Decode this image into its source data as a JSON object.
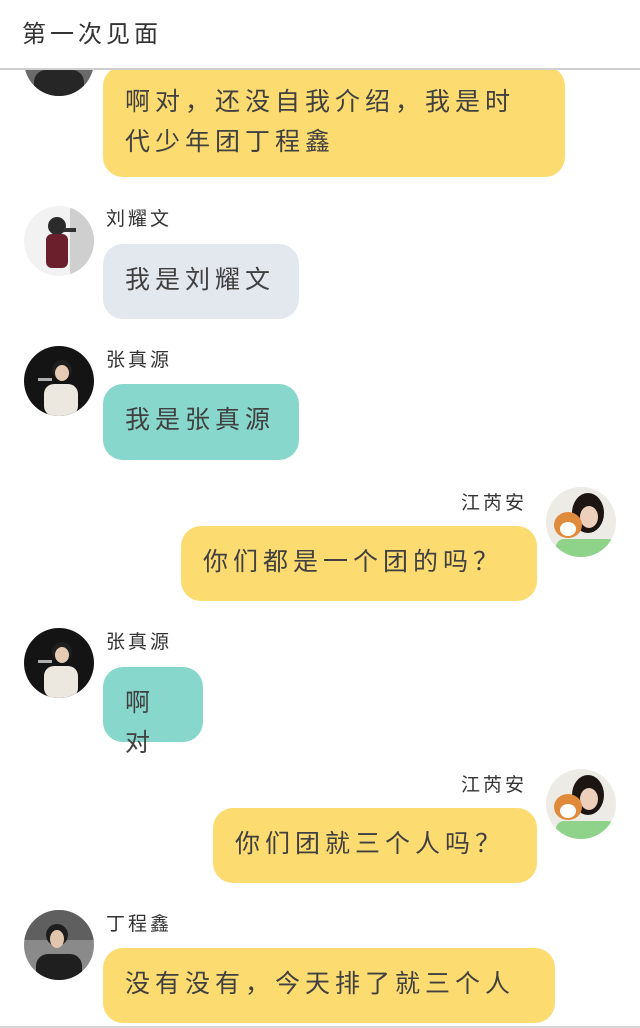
{
  "header": {
    "title": "第一次见面"
  },
  "messages": [
    {
      "sender": "",
      "text": "啊对，还没自我介绍，我是时代少年团丁程鑫",
      "color": "#fcdb71"
    },
    {
      "sender": "刘耀文",
      "text": "我是刘耀文",
      "color": "#e3e7ee"
    },
    {
      "sender": "张真源",
      "text": "我是张真源",
      "color": "#88d7cc"
    },
    {
      "sender": "江芮安",
      "text": "你们都是一个团的吗？",
      "color": "#fcdb71"
    },
    {
      "sender": "张真源",
      "text": "啊对",
      "color": "#88d7cc"
    },
    {
      "sender": "江芮安",
      "text": "你们团就三个人吗？",
      "color": "#fcdb71"
    },
    {
      "sender": "丁程鑫",
      "text": "没有没有，今天排了就三个人",
      "color": "#fcdb71"
    }
  ]
}
